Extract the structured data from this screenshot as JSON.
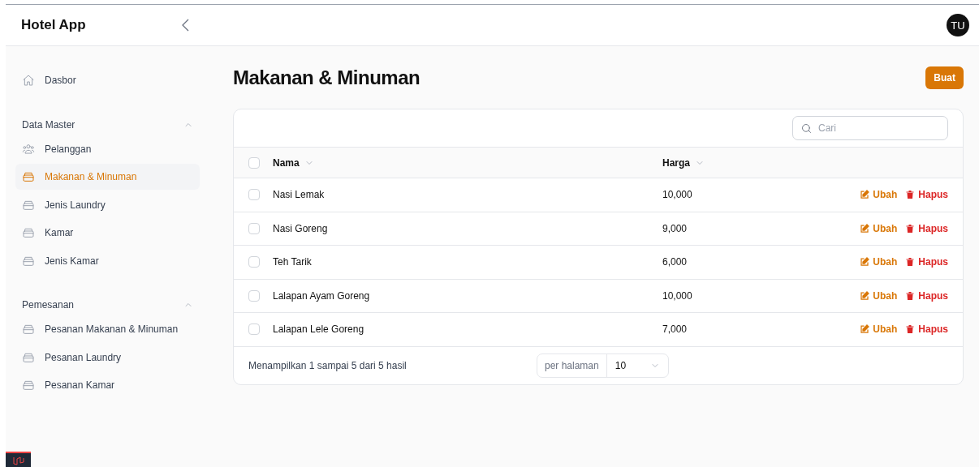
{
  "app": {
    "title": "Hotel App",
    "avatar": "TU"
  },
  "sidebar": {
    "items": [
      {
        "label": "Dasbor",
        "kind": "home",
        "selected": false
      }
    ],
    "groups": [
      {
        "title": "Data Master",
        "expanded": true,
        "items": [
          {
            "label": "Pelanggan",
            "kind": "users",
            "selected": false
          },
          {
            "label": "Makanan & Minuman",
            "kind": "box",
            "selected": true
          },
          {
            "label": "Jenis Laundry",
            "kind": "box",
            "selected": false
          },
          {
            "label": "Kamar",
            "kind": "box",
            "selected": false
          },
          {
            "label": "Jenis Kamar",
            "kind": "box",
            "selected": false
          }
        ]
      },
      {
        "title": "Pemesanan",
        "expanded": true,
        "items": [
          {
            "label": "Pesanan Makanan & Minuman",
            "kind": "box",
            "selected": false
          },
          {
            "label": "Pesanan Laundry",
            "kind": "box",
            "selected": false
          },
          {
            "label": "Pesanan Kamar",
            "kind": "box",
            "selected": false
          }
        ]
      }
    ]
  },
  "page": {
    "title": "Makanan & Minuman",
    "create_button": "Buat"
  },
  "table": {
    "search": {
      "placeholder": "Cari"
    },
    "select_all_checked": false,
    "columns": [
      "Nama",
      "Harga"
    ],
    "rows": [
      {
        "nama": "Nasi Lemak",
        "harga": "10,000",
        "checked": false,
        "edit": "Ubah",
        "delete": "Hapus"
      },
      {
        "nama": "Nasi Goreng",
        "harga": "9,000",
        "checked": false,
        "edit": "Ubah",
        "delete": "Hapus"
      },
      {
        "nama": "Teh Tarik",
        "harga": "6,000",
        "checked": false,
        "edit": "Ubah",
        "delete": "Hapus"
      },
      {
        "nama": "Lalapan Ayam Goreng",
        "harga": "10,000",
        "checked": false,
        "edit": "Ubah",
        "delete": "Hapus"
      },
      {
        "nama": "Lalapan Lele Goreng",
        "harga": "7,000",
        "checked": false,
        "edit": "Ubah",
        "delete": "Hapus"
      }
    ],
    "summary": "Menampilkan 1 sampai 5 dari 5 hasil",
    "per_page": {
      "label": "per halaman",
      "value": "10"
    }
  }
}
